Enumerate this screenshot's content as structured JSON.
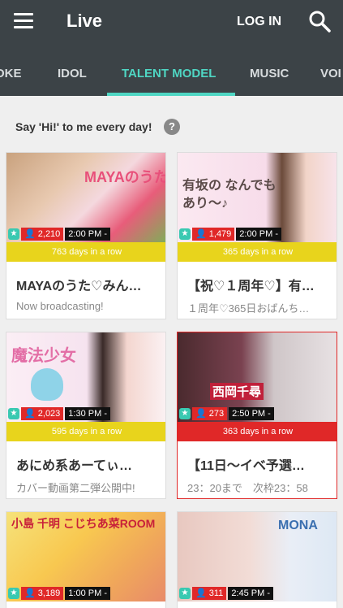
{
  "appbar": {
    "title": "Live",
    "login_label": "LOG IN",
    "menu_icon": "menu-icon",
    "search_icon": "search-icon"
  },
  "tabs": [
    {
      "label": "OKE"
    },
    {
      "label": "IDOL"
    },
    {
      "label": "TALENT MODEL",
      "active": true
    },
    {
      "label": "MUSIC"
    },
    {
      "label": "VOI"
    }
  ],
  "section": {
    "greeting": "Say 'Hi!' to me every day!",
    "help": "?"
  },
  "colors": {
    "appbar": "#3c4347",
    "accent": "#4fd6c3",
    "streak_yellow": "#e8d41c",
    "streak_red": "#e02828"
  },
  "cards": [
    {
      "thumb_text": "MAYAのうた",
      "viewers": "2,210",
      "time": "2:00 PM -",
      "streak": "763 days in a row",
      "streak_color": "yellow",
      "title": "MAYAのうた♡みん…",
      "subtitle": "Now broadcasting!"
    },
    {
      "thumb_text": "有坂の なんでもあり〜♪",
      "viewers": "1,479",
      "time": "2:00 PM -",
      "streak": "365 days in a row",
      "streak_color": "yellow",
      "title": "【祝♡１周年♡】有…",
      "subtitle": "１周年♡365日おばんち…"
    },
    {
      "thumb_text": "魔法少女",
      "viewers": "2,023",
      "time": "1:30 PM -",
      "streak": "595 days in a row",
      "streak_color": "yellow",
      "title": "あにめ系あーてぃ…",
      "subtitle": "カバー動画第二弾公開中!"
    },
    {
      "thumb_text": "西岡千尋",
      "viewers": "273",
      "time": "2:50 PM -",
      "streak": "363 days in a row",
      "streak_color": "red",
      "title": "【11日〜イベ予選…",
      "subtitle": "23：20まで　次枠23：58"
    },
    {
      "thumb_text": "小島 千明 こじちあ菜ROOM",
      "viewers": "3,189",
      "time": "1:00 PM -"
    },
    {
      "thumb_text": "MONA",
      "viewers": "311",
      "time": "2:45 PM -"
    }
  ]
}
